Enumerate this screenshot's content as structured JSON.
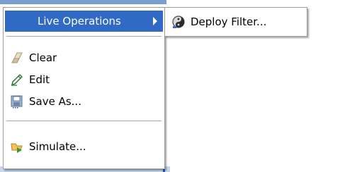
{
  "menu": {
    "items": [
      {
        "label": "Live Operations",
        "icon": "",
        "has_submenu": true
      },
      {
        "label": "Clear",
        "icon": "eraser-icon"
      },
      {
        "label": "Edit",
        "icon": "pencil-icon"
      },
      {
        "label": "Save As...",
        "icon": "floppy-disk-icon"
      },
      {
        "label": "Simulate...",
        "icon": "simulate-icon"
      }
    ]
  },
  "submenu": {
    "items": [
      {
        "label": "Deploy Filter...",
        "icon": "filter-icon"
      }
    ]
  },
  "colors": {
    "highlight": "#316ac5",
    "highlight_text": "#ffffff",
    "separator": "#a6a6a6"
  }
}
